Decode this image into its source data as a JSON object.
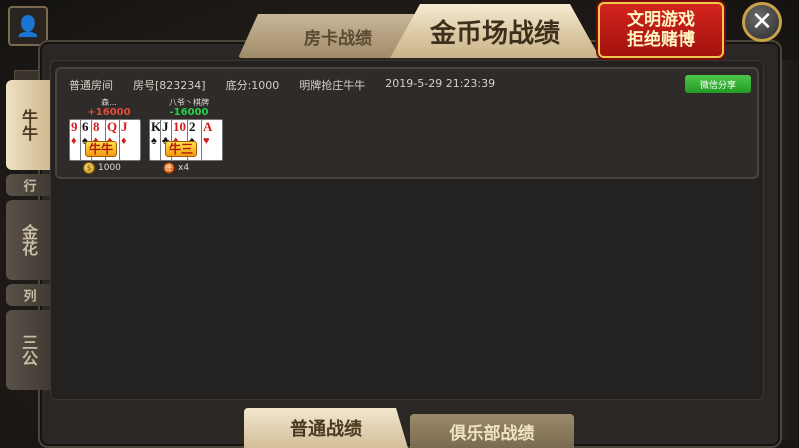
{
  "tabs": {
    "room_card": "房卡战绩",
    "coin": "金币场战绩"
  },
  "notice": {
    "line1": "文明游戏",
    "line2": "拒绝赌博"
  },
  "close_glyph": "✕",
  "side_tabs": [
    "牛牛",
    "金花",
    "三公"
  ],
  "side_dividers": [
    "行",
    "列"
  ],
  "record": {
    "room_type": "普通房间",
    "room_number": "房号[823234]",
    "base_score": "底分:1000",
    "game_mode": "明牌抢庄牛牛",
    "datetime": "2019-5-29 21:23:39",
    "share_label": "微信分享",
    "players": [
      {
        "name": "森...",
        "score": "+16000",
        "hand_label": "牛牛",
        "footer_text": "1000",
        "footer_icon": "coin-icon",
        "cards": [
          {
            "rank": "9",
            "suit": "♦",
            "color": "red"
          },
          {
            "rank": "6",
            "suit": "♠",
            "color": "black"
          },
          {
            "rank": "8",
            "suit": "♦",
            "color": "red"
          },
          {
            "rank": "Q",
            "suit": "♦",
            "color": "red"
          },
          {
            "rank": "J",
            "suit": "♦",
            "color": "red"
          }
        ]
      },
      {
        "name": "八爷丶棋牌",
        "score": "-16000",
        "hand_label": "牛三",
        "footer_text": "x4",
        "footer_icon": "dealer-icon",
        "cards": [
          {
            "rank": "K",
            "suit": "♠",
            "color": "black"
          },
          {
            "rank": "J",
            "suit": "♣",
            "color": "black"
          },
          {
            "rank": "10",
            "suit": "♦",
            "color": "red"
          },
          {
            "rank": "2",
            "suit": "♠",
            "color": "black"
          },
          {
            "rank": "A",
            "suit": "♥",
            "color": "red"
          }
        ]
      }
    ]
  },
  "bottom_tabs": {
    "normal": "普通战绩",
    "club": "俱乐部战绩"
  }
}
